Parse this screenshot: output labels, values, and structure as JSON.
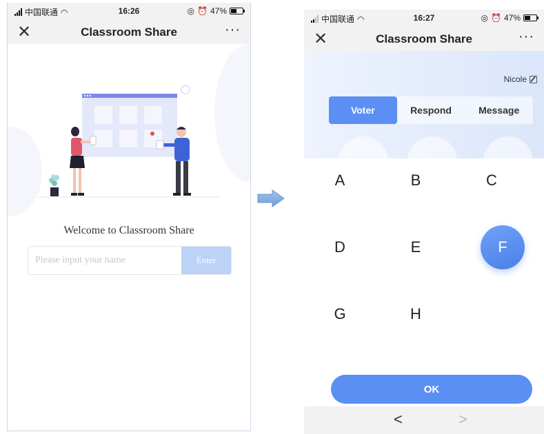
{
  "screens": [
    {
      "status": {
        "carrier": "中国联通",
        "time": "16:26",
        "battery": "47%",
        "battery_level": 0.47
      },
      "nav": {
        "close_icon": "close-icon",
        "title": "Classroom Share",
        "more_icon": "more-icon",
        "more_glyph": "···"
      },
      "illustration_icon": "classroom-illustration",
      "welcome_text": "Welcome to Classroom Share",
      "name_input": {
        "placeholder": "Please input your name",
        "value": ""
      },
      "enter_button": "Enter"
    },
    {
      "status": {
        "carrier": "中国联通",
        "time": "16:27",
        "battery": "47%",
        "battery_level": 0.47
      },
      "nav": {
        "close_icon": "close-icon",
        "title": "Classroom Share",
        "more_icon": "more-icon",
        "more_glyph": "···"
      },
      "username": "Nicole",
      "tabs": [
        {
          "label": "Voter",
          "active": true
        },
        {
          "label": "Respond",
          "active": false
        },
        {
          "label": "Message",
          "active": false
        }
      ],
      "options": [
        "A",
        "B",
        "C",
        "D",
        "E",
        "F",
        "G",
        "H"
      ],
      "selected_option": "F",
      "ok_button": "OK",
      "bottom_nav": {
        "back_glyph": "<",
        "forward_glyph": ">"
      }
    }
  ],
  "arrow_icon": "right-arrow-icon",
  "colors": {
    "accent": "#5b8ff4",
    "enter_button": "#bcd2f7",
    "header_gradient_end": "#dbe6fb"
  }
}
